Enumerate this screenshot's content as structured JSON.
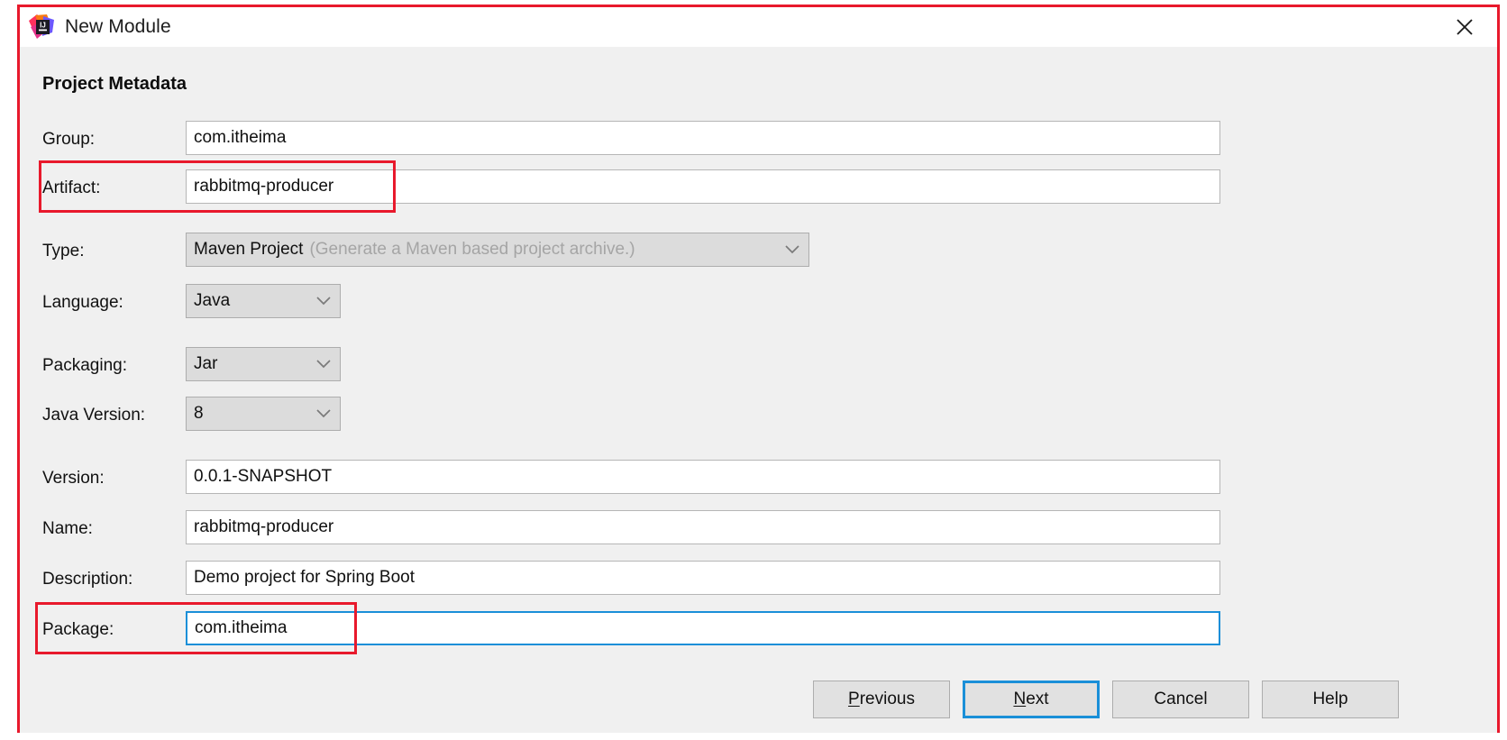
{
  "window": {
    "title": "New Module",
    "logo_icon": "intellij-idea-logo",
    "close_icon": "close-x-icon"
  },
  "section": {
    "heading": "Project Metadata"
  },
  "colors": {
    "annotation_red": "#e8192c",
    "focus_blue": "#1a8fd8",
    "dialog_bg": "#f0f0f0",
    "combo_bg": "#dcdcdc",
    "hint_grey": "#a5a5a5"
  },
  "fields": {
    "group": {
      "label": "Group:",
      "value": "com.itheima"
    },
    "artifact": {
      "label": "Artifact:",
      "value": "rabbitmq-producer"
    },
    "type": {
      "label": "Type:",
      "value": "Maven Project",
      "hint": "(Generate a Maven based project archive.)",
      "chevron_icon": "chevron-down-icon"
    },
    "language": {
      "label": "Language:",
      "value": "Java",
      "chevron_icon": "chevron-down-icon"
    },
    "packaging": {
      "label": "Packaging:",
      "value": "Jar",
      "chevron_icon": "chevron-down-icon"
    },
    "java_version": {
      "label": "Java Version:",
      "value": "8",
      "chevron_icon": "chevron-down-icon"
    },
    "version": {
      "label": "Version:",
      "value": "0.0.1-SNAPSHOT"
    },
    "name": {
      "label": "Name:",
      "value": "rabbitmq-producer"
    },
    "description": {
      "label": "Description:",
      "value": "Demo project for Spring Boot"
    },
    "package": {
      "label": "Package:",
      "value": "com.itheima"
    }
  },
  "buttons": {
    "previous": {
      "mnemonic": "P",
      "rest": "revious"
    },
    "next": {
      "mnemonic": "N",
      "rest": "ext"
    },
    "cancel": {
      "label": "Cancel"
    },
    "help": {
      "label": "Help"
    }
  }
}
